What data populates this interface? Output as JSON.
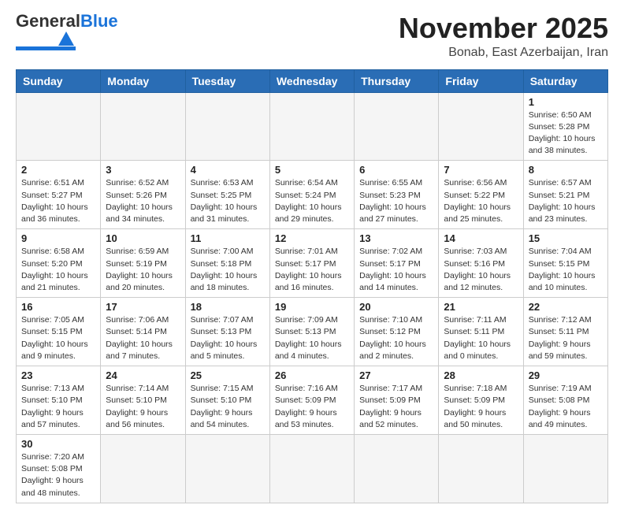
{
  "logo": {
    "text_general": "General",
    "text_blue": "Blue"
  },
  "header": {
    "month": "November 2025",
    "location": "Bonab, East Azerbaijan, Iran"
  },
  "weekdays": [
    "Sunday",
    "Monday",
    "Tuesday",
    "Wednesday",
    "Thursday",
    "Friday",
    "Saturday"
  ],
  "weeks": [
    [
      {
        "day": "",
        "info": ""
      },
      {
        "day": "",
        "info": ""
      },
      {
        "day": "",
        "info": ""
      },
      {
        "day": "",
        "info": ""
      },
      {
        "day": "",
        "info": ""
      },
      {
        "day": "",
        "info": ""
      },
      {
        "day": "1",
        "info": "Sunrise: 6:50 AM\nSunset: 5:28 PM\nDaylight: 10 hours and 38 minutes."
      }
    ],
    [
      {
        "day": "2",
        "info": "Sunrise: 6:51 AM\nSunset: 5:27 PM\nDaylight: 10 hours and 36 minutes."
      },
      {
        "day": "3",
        "info": "Sunrise: 6:52 AM\nSunset: 5:26 PM\nDaylight: 10 hours and 34 minutes."
      },
      {
        "day": "4",
        "info": "Sunrise: 6:53 AM\nSunset: 5:25 PM\nDaylight: 10 hours and 31 minutes."
      },
      {
        "day": "5",
        "info": "Sunrise: 6:54 AM\nSunset: 5:24 PM\nDaylight: 10 hours and 29 minutes."
      },
      {
        "day": "6",
        "info": "Sunrise: 6:55 AM\nSunset: 5:23 PM\nDaylight: 10 hours and 27 minutes."
      },
      {
        "day": "7",
        "info": "Sunrise: 6:56 AM\nSunset: 5:22 PM\nDaylight: 10 hours and 25 minutes."
      },
      {
        "day": "8",
        "info": "Sunrise: 6:57 AM\nSunset: 5:21 PM\nDaylight: 10 hours and 23 minutes."
      }
    ],
    [
      {
        "day": "9",
        "info": "Sunrise: 6:58 AM\nSunset: 5:20 PM\nDaylight: 10 hours and 21 minutes."
      },
      {
        "day": "10",
        "info": "Sunrise: 6:59 AM\nSunset: 5:19 PM\nDaylight: 10 hours and 20 minutes."
      },
      {
        "day": "11",
        "info": "Sunrise: 7:00 AM\nSunset: 5:18 PM\nDaylight: 10 hours and 18 minutes."
      },
      {
        "day": "12",
        "info": "Sunrise: 7:01 AM\nSunset: 5:17 PM\nDaylight: 10 hours and 16 minutes."
      },
      {
        "day": "13",
        "info": "Sunrise: 7:02 AM\nSunset: 5:17 PM\nDaylight: 10 hours and 14 minutes."
      },
      {
        "day": "14",
        "info": "Sunrise: 7:03 AM\nSunset: 5:16 PM\nDaylight: 10 hours and 12 minutes."
      },
      {
        "day": "15",
        "info": "Sunrise: 7:04 AM\nSunset: 5:15 PM\nDaylight: 10 hours and 10 minutes."
      }
    ],
    [
      {
        "day": "16",
        "info": "Sunrise: 7:05 AM\nSunset: 5:15 PM\nDaylight: 10 hours and 9 minutes."
      },
      {
        "day": "17",
        "info": "Sunrise: 7:06 AM\nSunset: 5:14 PM\nDaylight: 10 hours and 7 minutes."
      },
      {
        "day": "18",
        "info": "Sunrise: 7:07 AM\nSunset: 5:13 PM\nDaylight: 10 hours and 5 minutes."
      },
      {
        "day": "19",
        "info": "Sunrise: 7:09 AM\nSunset: 5:13 PM\nDaylight: 10 hours and 4 minutes."
      },
      {
        "day": "20",
        "info": "Sunrise: 7:10 AM\nSunset: 5:12 PM\nDaylight: 10 hours and 2 minutes."
      },
      {
        "day": "21",
        "info": "Sunrise: 7:11 AM\nSunset: 5:11 PM\nDaylight: 10 hours and 0 minutes."
      },
      {
        "day": "22",
        "info": "Sunrise: 7:12 AM\nSunset: 5:11 PM\nDaylight: 9 hours and 59 minutes."
      }
    ],
    [
      {
        "day": "23",
        "info": "Sunrise: 7:13 AM\nSunset: 5:10 PM\nDaylight: 9 hours and 57 minutes."
      },
      {
        "day": "24",
        "info": "Sunrise: 7:14 AM\nSunset: 5:10 PM\nDaylight: 9 hours and 56 minutes."
      },
      {
        "day": "25",
        "info": "Sunrise: 7:15 AM\nSunset: 5:10 PM\nDaylight: 9 hours and 54 minutes."
      },
      {
        "day": "26",
        "info": "Sunrise: 7:16 AM\nSunset: 5:09 PM\nDaylight: 9 hours and 53 minutes."
      },
      {
        "day": "27",
        "info": "Sunrise: 7:17 AM\nSunset: 5:09 PM\nDaylight: 9 hours and 52 minutes."
      },
      {
        "day": "28",
        "info": "Sunrise: 7:18 AM\nSunset: 5:09 PM\nDaylight: 9 hours and 50 minutes."
      },
      {
        "day": "29",
        "info": "Sunrise: 7:19 AM\nSunset: 5:08 PM\nDaylight: 9 hours and 49 minutes."
      }
    ],
    [
      {
        "day": "30",
        "info": "Sunrise: 7:20 AM\nSunset: 5:08 PM\nDaylight: 9 hours and 48 minutes."
      },
      {
        "day": "",
        "info": ""
      },
      {
        "day": "",
        "info": ""
      },
      {
        "day": "",
        "info": ""
      },
      {
        "day": "",
        "info": ""
      },
      {
        "day": "",
        "info": ""
      },
      {
        "day": "",
        "info": ""
      }
    ]
  ]
}
